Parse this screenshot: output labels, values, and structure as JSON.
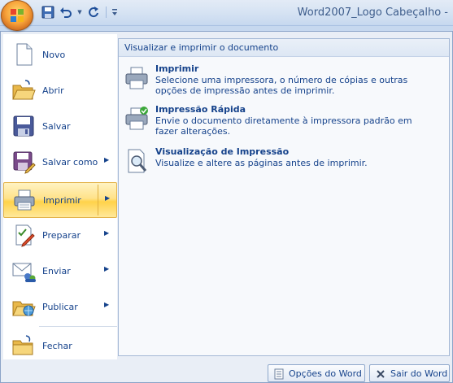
{
  "window": {
    "title": "Word2007_Logo Cabeçalho - "
  },
  "quick_access": {
    "icons": [
      "save-icon",
      "undo-icon",
      "redo-icon",
      "customize-icon"
    ]
  },
  "left_menu": {
    "items": [
      {
        "label": "Novo",
        "has_submenu": false,
        "icon": "new-document-icon"
      },
      {
        "label": "Abrir",
        "has_submenu": false,
        "icon": "open-folder-icon"
      },
      {
        "label": "Salvar",
        "has_submenu": false,
        "icon": "save-icon"
      },
      {
        "label": "Salvar como",
        "has_submenu": true,
        "icon": "save-as-icon"
      },
      {
        "label": "Imprimir",
        "has_submenu": true,
        "icon": "printer-icon",
        "active": true
      },
      {
        "label": "Preparar",
        "has_submenu": true,
        "icon": "prepare-icon"
      },
      {
        "label": "Enviar",
        "has_submenu": true,
        "icon": "send-icon"
      },
      {
        "label": "Publicar",
        "has_submenu": true,
        "icon": "publish-icon"
      },
      {
        "label": "Fechar",
        "has_submenu": false,
        "icon": "close-folder-icon"
      }
    ],
    "submenu_arrow": "▶"
  },
  "right_pane": {
    "header": "Visualizar e imprimir o documento",
    "options": [
      {
        "title": "Imprimir",
        "description": "Selecione uma impressora, o número de cópias e outras opções de impressão antes de imprimir.",
        "icon": "printer-icon"
      },
      {
        "title": "Impressão Rápida",
        "description": "Envie o documento diretamente à impressora padrão em fazer alterações.",
        "icon": "quick-print-icon"
      },
      {
        "title": "Visualização de Impressão",
        "description": "Visualize e altere as páginas antes de imprimir.",
        "icon": "print-preview-icon"
      }
    ]
  },
  "bottom_buttons": {
    "options_label": "Opções do Word",
    "exit_label": "Sair do Word"
  },
  "colors": {
    "accent_text": "#15428b",
    "active_highlight": "#ffd24a",
    "menu_background": "#e9eef6"
  }
}
